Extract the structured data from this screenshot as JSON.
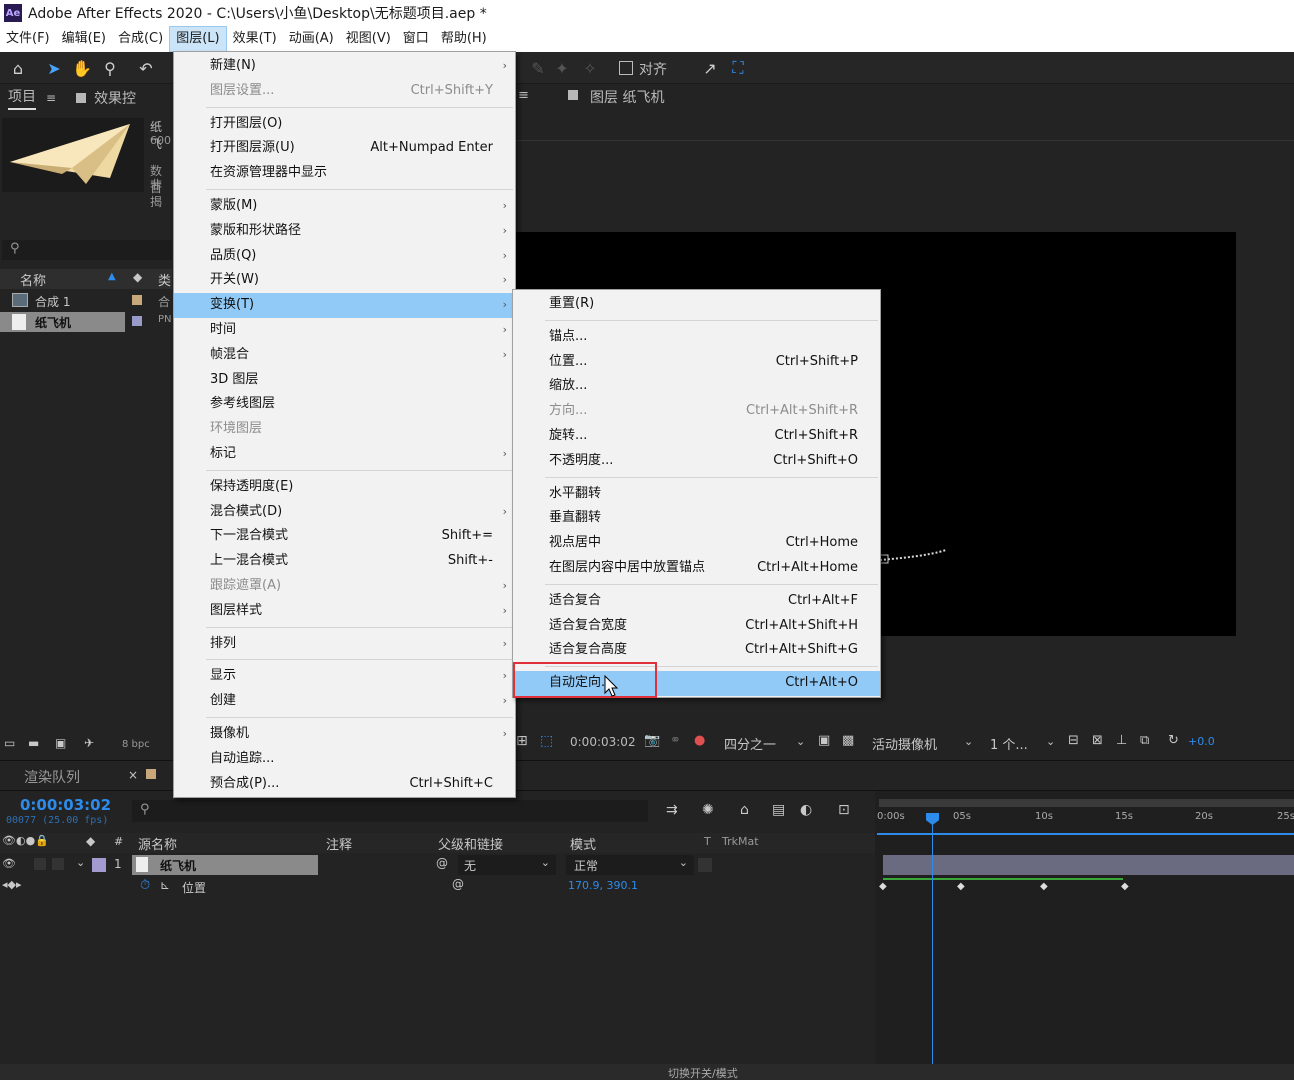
{
  "app": {
    "logo": "Ae",
    "title": "Adobe After Effects 2020 - C:\\Users\\小鱼\\Desktop\\无标题项目.aep *"
  },
  "menubar": [
    "文件(F)",
    "编辑(E)",
    "合成(C)",
    "图层(L)",
    "效果(T)",
    "动画(A)",
    "视图(V)",
    "窗口",
    "帮助(H)"
  ],
  "toolbar": {
    "align_label": "对齐"
  },
  "project_panel": {
    "tab_project": "项目",
    "tab_effects": "效果控",
    "preview_name": "纸飞",
    "preview_dims": "600",
    "preview_line3": "数百",
    "preview_line4": "非揭",
    "col_name": "名称",
    "col_type": "类",
    "items": [
      {
        "name": "合成 1",
        "type": "合"
      },
      {
        "name": "纸飞机",
        "type": "PN"
      }
    ],
    "bpc": "8 bpc"
  },
  "viewer": {
    "tab_layer": "图层 纸飞机",
    "timecode": "0:00:03:02",
    "resolution": "四分之一",
    "camera": "活动摄像机",
    "views": "1 个...",
    "exposure": "+0.0"
  },
  "layer_menu": {
    "items": [
      {
        "label": "新建(N)",
        "shortcut": "",
        "submenu": true,
        "disabled": false
      },
      {
        "label": "图层设置...",
        "shortcut": "Ctrl+Shift+Y",
        "submenu": false,
        "disabled": true
      },
      {
        "sep": true
      },
      {
        "label": "打开图层(O)",
        "shortcut": "",
        "submenu": false,
        "disabled": false
      },
      {
        "label": "打开图层源(U)",
        "shortcut": "Alt+Numpad Enter",
        "submenu": false,
        "disabled": false
      },
      {
        "label": "在资源管理器中显示",
        "shortcut": "",
        "submenu": false,
        "disabled": false
      },
      {
        "sep": true
      },
      {
        "label": "蒙版(M)",
        "shortcut": "",
        "submenu": true,
        "disabled": false
      },
      {
        "label": "蒙版和形状路径",
        "shortcut": "",
        "submenu": true,
        "disabled": false
      },
      {
        "label": "品质(Q)",
        "shortcut": "",
        "submenu": true,
        "disabled": false
      },
      {
        "label": "开关(W)",
        "shortcut": "",
        "submenu": true,
        "disabled": false
      },
      {
        "label": "变换(T)",
        "shortcut": "",
        "submenu": true,
        "disabled": false,
        "highlight": true
      },
      {
        "label": "时间",
        "shortcut": "",
        "submenu": true,
        "disabled": false
      },
      {
        "label": "帧混合",
        "shortcut": "",
        "submenu": true,
        "disabled": false
      },
      {
        "label": "3D 图层",
        "shortcut": "",
        "submenu": false,
        "disabled": false
      },
      {
        "label": "参考线图层",
        "shortcut": "",
        "submenu": false,
        "disabled": false
      },
      {
        "label": "环境图层",
        "shortcut": "",
        "submenu": false,
        "disabled": true
      },
      {
        "label": "标记",
        "shortcut": "",
        "submenu": true,
        "disabled": false
      },
      {
        "sep": true
      },
      {
        "label": "保持透明度(E)",
        "shortcut": "",
        "submenu": false,
        "disabled": false
      },
      {
        "label": "混合模式(D)",
        "shortcut": "",
        "submenu": true,
        "disabled": false
      },
      {
        "label": "下一混合模式",
        "shortcut": "Shift+=",
        "submenu": false,
        "disabled": false
      },
      {
        "label": "上一混合模式",
        "shortcut": "Shift+-",
        "submenu": false,
        "disabled": false
      },
      {
        "label": "跟踪遮罩(A)",
        "shortcut": "",
        "submenu": true,
        "disabled": true
      },
      {
        "label": "图层样式",
        "shortcut": "",
        "submenu": true,
        "disabled": false
      },
      {
        "sep": true
      },
      {
        "label": "排列",
        "shortcut": "",
        "submenu": true,
        "disabled": false
      },
      {
        "sep": true
      },
      {
        "label": "显示",
        "shortcut": "",
        "submenu": true,
        "disabled": false
      },
      {
        "label": "创建",
        "shortcut": "",
        "submenu": true,
        "disabled": false
      },
      {
        "sep": true
      },
      {
        "label": "摄像机",
        "shortcut": "",
        "submenu": true,
        "disabled": false
      },
      {
        "label": "自动追踪...",
        "shortcut": "",
        "submenu": false,
        "disabled": false
      },
      {
        "label": "预合成(P)...",
        "shortcut": "Ctrl+Shift+C",
        "submenu": false,
        "disabled": false
      }
    ]
  },
  "transform_menu": {
    "items": [
      {
        "label": "重置(R)",
        "shortcut": "",
        "disabled": false
      },
      {
        "sep": true
      },
      {
        "label": "锚点...",
        "shortcut": "",
        "disabled": false
      },
      {
        "label": "位置...",
        "shortcut": "Ctrl+Shift+P",
        "disabled": false
      },
      {
        "label": "缩放...",
        "shortcut": "",
        "disabled": false
      },
      {
        "label": "方向...",
        "shortcut": "Ctrl+Alt+Shift+R",
        "disabled": true
      },
      {
        "label": "旋转...",
        "shortcut": "Ctrl+Shift+R",
        "disabled": false
      },
      {
        "label": "不透明度...",
        "shortcut": "Ctrl+Shift+O",
        "disabled": false
      },
      {
        "sep": true
      },
      {
        "label": "水平翻转",
        "shortcut": "",
        "disabled": false
      },
      {
        "label": "垂直翻转",
        "shortcut": "",
        "disabled": false
      },
      {
        "label": "视点居中",
        "shortcut": "Ctrl+Home",
        "disabled": false
      },
      {
        "label": "在图层内容中居中放置锚点",
        "shortcut": "Ctrl+Alt+Home",
        "disabled": false
      },
      {
        "sep": true
      },
      {
        "label": "适合复合",
        "shortcut": "Ctrl+Alt+F",
        "disabled": false
      },
      {
        "label": "适合复合宽度",
        "shortcut": "Ctrl+Alt+Shift+H",
        "disabled": false
      },
      {
        "label": "适合复合高度",
        "shortcut": "Ctrl+Alt+Shift+G",
        "disabled": false
      },
      {
        "sep": true
      },
      {
        "label": "自动定向...",
        "shortcut": "Ctrl+Alt+O",
        "disabled": false,
        "highlight": true
      }
    ]
  },
  "timeline": {
    "tab_render_queue": "渲染队列",
    "current_time": "0:00:03:02",
    "frame_info": "00077 (25.00 fps)",
    "col_source": "源名称",
    "col_comment": "注释",
    "col_parent": "父级和链接",
    "col_mode": "模式",
    "col_t": "T",
    "col_trkmat": "TrkMat",
    "layer_number": "1",
    "layer_name": "纸飞机",
    "parent_value": "无",
    "mode_value": "正常",
    "prop_name": "位置",
    "prop_value": "170.9, 390.1",
    "ruler": [
      "0:00s",
      "05s",
      "10s",
      "15s",
      "20s",
      "25s"
    ],
    "footer": "切换开关/模式"
  },
  "colors": {
    "menu_bg": "#f2f2f2",
    "menu_highlight": "#91c9f7",
    "accent_blue": "#2d8ceb",
    "highlight_box": "#e0303a"
  }
}
